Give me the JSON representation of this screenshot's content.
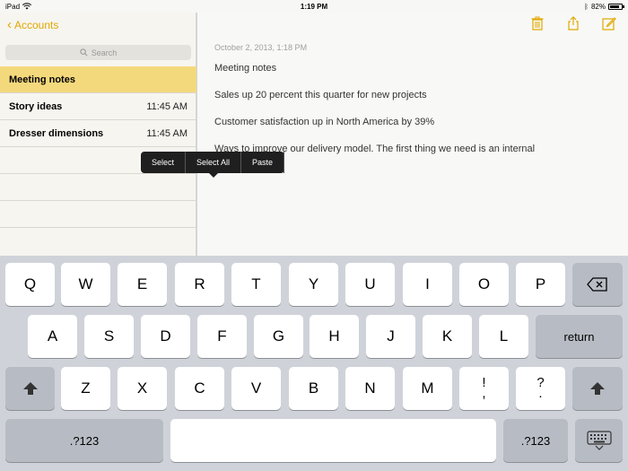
{
  "status_bar": {
    "device": "iPad",
    "time": "1:19 PM",
    "battery_text": "82%",
    "battery_level": 0.82
  },
  "sidebar": {
    "back_label": "Accounts",
    "search_placeholder": "Search",
    "notes": [
      {
        "title": "Meeting notes",
        "time": "",
        "selected": true
      },
      {
        "title": "Story ideas",
        "time": "11:45 AM",
        "selected": false
      },
      {
        "title": "Dresser dimensions",
        "time": "11:45 AM",
        "selected": false
      }
    ]
  },
  "note": {
    "date": "October 2, 2013, 1:18 PM",
    "lines": [
      "Meeting notes",
      "Sales up 20 percent this quarter for new projects",
      "Customer satisfaction up in North America by 39%",
      "Ways to improve our delivery model.  The first thing we need is an internal"
    ]
  },
  "edit_menu": {
    "select": "Select",
    "select_all": "Select All",
    "paste": "Paste"
  },
  "keyboard": {
    "row1": [
      "Q",
      "W",
      "E",
      "R",
      "T",
      "Y",
      "U",
      "I",
      "O",
      "P"
    ],
    "row2": [
      "A",
      "S",
      "D",
      "F",
      "G",
      "H",
      "J",
      "K",
      "L"
    ],
    "row3": [
      "Z",
      "X",
      "C",
      "V",
      "B",
      "N",
      "M"
    ],
    "return_label": "return",
    "numbers_label": ".?123",
    "punct1_top": "!",
    "punct1_bottom": ",",
    "punct2_top": "?",
    "punct2_bottom": "."
  },
  "colors": {
    "accent": "#e0a800",
    "selected_row": "#f4d97c"
  }
}
